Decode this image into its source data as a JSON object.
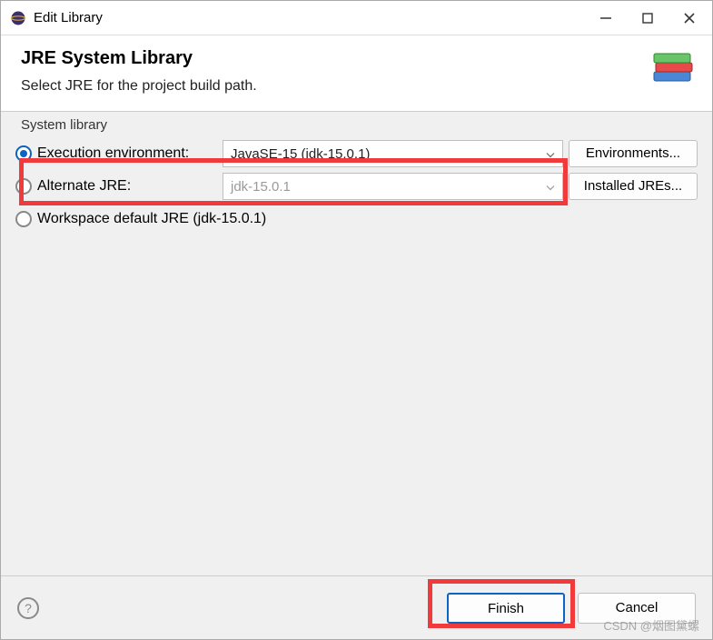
{
  "window": {
    "title": "Edit Library"
  },
  "header": {
    "title": "JRE System Library",
    "subtitle": "Select JRE for the project build path."
  },
  "group": {
    "title": "System library",
    "rows": [
      {
        "label": "Execution environment:",
        "combo": "JavaSE-15 (jdk-15.0.1)",
        "button": "Environments...",
        "selected": true,
        "combo_enabled": true
      },
      {
        "label": "Alternate JRE:",
        "combo": "jdk-15.0.1",
        "button": "Installed JREs...",
        "selected": false,
        "combo_enabled": false
      },
      {
        "label": "Workspace default JRE (jdk-15.0.1)",
        "combo": null,
        "button": null,
        "selected": false
      }
    ]
  },
  "footer": {
    "finish": "Finish",
    "cancel": "Cancel"
  },
  "watermark": "CSDN @烟图黛螺"
}
